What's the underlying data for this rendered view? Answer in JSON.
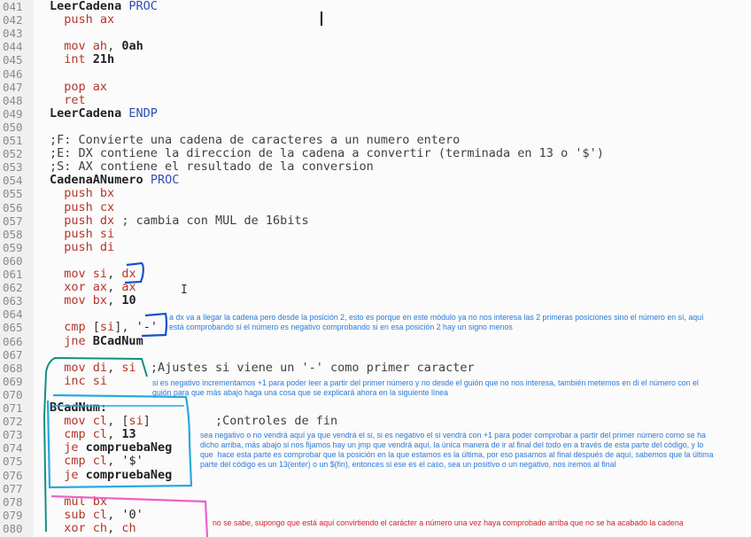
{
  "lines": [
    {
      "n": "041",
      "html": "<span class='lbl'>LeerCadena</span> <span class='proc'>PROC</span>"
    },
    {
      "n": "042",
      "html": "  <span class='kw'>push</span> <span class='kw'>ax</span>"
    },
    {
      "n": "043",
      "html": ""
    },
    {
      "n": "044",
      "html": "  <span class='kw'>mov</span> <span class='kw'>ah</span>, <span class='num'>0ah</span>"
    },
    {
      "n": "045",
      "html": "  <span class='kw'>int</span> <span class='num'>21h</span>"
    },
    {
      "n": "046",
      "html": ""
    },
    {
      "n": "047",
      "html": "  <span class='kw'>pop</span> <span class='kw'>ax</span>"
    },
    {
      "n": "048",
      "html": "  <span class='kw'>ret</span>"
    },
    {
      "n": "049",
      "html": "<span class='lbl'>LeerCadena</span> <span class='proc'>ENDP</span>"
    },
    {
      "n": "050",
      "html": ""
    },
    {
      "n": "051",
      "html": "<span class='cm'>;F: Convierte una cadena de caracteres a un numero entero</span>"
    },
    {
      "n": "052",
      "html": "<span class='cm'>;E: DX contiene la direccion de la cadena a convertir (terminada en 13 o '$')</span>"
    },
    {
      "n": "053",
      "html": "<span class='cm'>;S: AX contiene el resultado de la conversion</span>"
    },
    {
      "n": "054",
      "html": "<span class='lbl'>CadenaANumero</span> <span class='proc'>PROC</span>"
    },
    {
      "n": "055",
      "html": "  <span class='kw'>push</span> <span class='kw'>bx</span>"
    },
    {
      "n": "056",
      "html": "  <span class='kw'>push</span> <span class='kw'>cx</span>"
    },
    {
      "n": "057",
      "html": "  <span class='kw'>push</span> <span class='kw'>dx</span> <span class='cm'>; cambia con MUL de 16bits</span>"
    },
    {
      "n": "058",
      "html": "  <span class='kw'>push</span> <span class='kw'>si</span>"
    },
    {
      "n": "059",
      "html": "  <span class='kw'>push</span> <span class='kw'>di</span>"
    },
    {
      "n": "060",
      "html": ""
    },
    {
      "n": "061",
      "html": "  <span class='kw'>mov</span> <span class='kw'>si</span>, <span class='kw'>dx</span>"
    },
    {
      "n": "062",
      "html": "  <span class='kw'>xor</span> <span class='kw'>ax</span>, <span class='kw'>ax</span>"
    },
    {
      "n": "063",
      "html": "  <span class='kw'>mov</span> <span class='kw'>bx</span>, <span class='num'>10</span>"
    },
    {
      "n": "064",
      "html": ""
    },
    {
      "n": "065",
      "html": "  <span class='kw'>cmp</span> [<span class='kw'>si</span>], <span class='str'>'-'</span>"
    },
    {
      "n": "066",
      "html": "  <span class='kw'>jne</span> <span class='lbl'>BCadNum</span>"
    },
    {
      "n": "067",
      "html": ""
    },
    {
      "n": "068",
      "html": "  <span class='kw'>mov</span> <span class='kw'>di</span>, <span class='kw'>si</span>  <span class='cm'>;Ajustes si viene un '-' como primer caracter</span>"
    },
    {
      "n": "069",
      "html": "  <span class='kw'>inc</span> <span class='kw'>si</span>"
    },
    {
      "n": "070",
      "html": ""
    },
    {
      "n": "071",
      "html": "<span class='lbl'>BCadNum:</span>"
    },
    {
      "n": "072",
      "html": "  <span class='kw'>mov</span> <span class='kw'>cl</span>, [<span class='kw'>si</span>]         <span class='cm'>;Controles de fin</span>"
    },
    {
      "n": "073",
      "html": "  <span class='kw'>cmp</span> <span class='kw'>cl</span>, <span class='num'>13</span>"
    },
    {
      "n": "074",
      "html": "  <span class='kw'>je</span> <span class='lbl'>compruebaNeg</span>"
    },
    {
      "n": "075",
      "html": "  <span class='kw'>cmp</span> <span class='kw'>cl</span>, <span class='str'>'$'</span>"
    },
    {
      "n": "076",
      "html": "  <span class='kw'>je</span> <span class='lbl'>compruebaNeg</span>"
    },
    {
      "n": "077",
      "html": ""
    },
    {
      "n": "078",
      "html": "  <span class='kw'>mul</span> <span class='kw'>bx</span>"
    },
    {
      "n": "079",
      "html": "  <span class='kw'>sub</span> <span class='kw'>cl</span>, <span class='str'>'0'</span>"
    },
    {
      "n": "080",
      "html": "  <span class='kw'>xor</span> <span class='kw'>ch</span>, <span class='kw'>ch</span>"
    }
  ],
  "notes": {
    "n1": "a dx va a llegar la cadena pero desde la posición 2, esto es porque en este módulo ya no nos interesa las 2 primeras posiciones sino el número en sí, aquí\nestá comprobando si el número es negativo comprobando si en esa posición 2 hay un signo menos",
    "n2": "si es negativo incrementamos +1 para poder leer a partir del primer número y no desde el guión que no nos interesa, también metemos en di el número con el\nguión para que más abajo haga una cosa que se explicará ahora en la siguiente línea",
    "n3": "sea negativo o no vendrá aquí ya que vendrá el si, si es negativo el si vendrá con +1 para poder comprobar a partir del primer número como se ha\ndicho arriba, más abajo si nos fijamos hay un jmp que vendrá aquí, la única manera de ir al final del todo en a través de esta parte del código, y lo\nque  hace esta parte es comprobar que la posición en la que estamos es la última, por eso pasamos al final después de aquí, sabemos que la última\nparte del código es un 13(enter) o un $(fin), entonces si ese es el caso, sea un positivo o un negativo, nos iremos al final",
    "n4": "no se sabe, supongo que está aquí convirtiendo el carácter a número una vez haya comprobado arriba que no se ha acabado la cadena"
  },
  "colors": {
    "keyword": "#b5352a",
    "note_blue": "#2a7ad8",
    "note_red": "#d2222a",
    "ann_blue": "#1450d0",
    "ann_green": "#14907a",
    "ann_cyan": "#2aa8e0",
    "ann_pink": "#f060c8"
  }
}
